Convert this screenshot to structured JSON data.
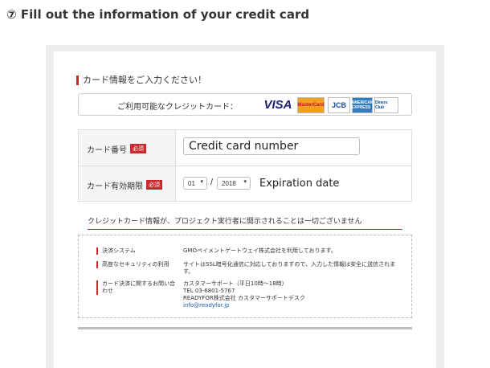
{
  "step_title": "⑦ Fill out the information of your credit card",
  "section_heading": "カード情報をご入力ください！",
  "brands": {
    "label": "ご利用可能なクレジットカード：",
    "cards": [
      "VISA",
      "MasterCard",
      "JCB",
      "AMERICAN EXPRESS",
      "Diners Club"
    ]
  },
  "form": {
    "card_number": {
      "label": "カード番号",
      "required_badge": "必須",
      "input_value": "Credit card number"
    },
    "expiration": {
      "label": "カード有効期限",
      "required_badge": "必須",
      "month_value": "01",
      "separator": "/",
      "year_value": "2018",
      "annotation": "Expiration date"
    }
  },
  "notice": "クレジットカード情報が、プロジェクト実行者に開示されることは一切ございません",
  "info": {
    "rows": [
      {
        "key": "決済システム",
        "value": "GMOペイメントゲートウェイ株式会社を利用しております。"
      },
      {
        "key": "高度なセキュリティの利用",
        "value": "サイトはSSL暗号化通信に対応しておりますので、入力した情報は安全に送信されます。"
      },
      {
        "key": "カード決済に関するお問い合わせ",
        "value_lines": [
          "カスタマーサポート（平日10時〜18時）",
          "TEL 03-6801-5767",
          "READYFOR株式会社 カスタマーサポートデスク"
        ],
        "email": "info@readyfor.jp"
      }
    ]
  }
}
